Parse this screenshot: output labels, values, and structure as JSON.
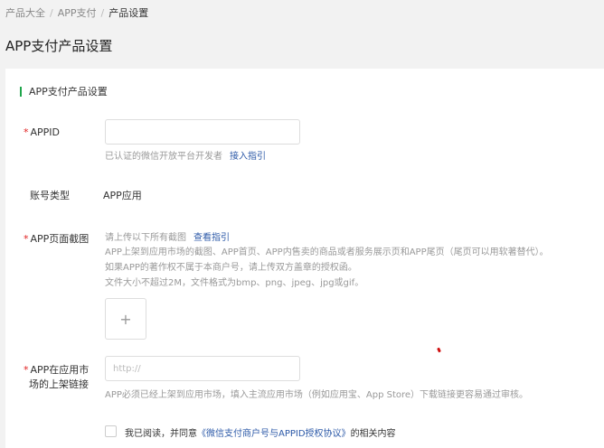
{
  "breadcrumb": {
    "items": [
      "产品大全",
      "APP支付",
      "产品设置"
    ]
  },
  "page_title": "APP支付产品设置",
  "section_title": "APP支付产品设置",
  "fields": {
    "appid": {
      "label": "APPID",
      "value": "",
      "hint": "已认证的微信开放平台开发者",
      "hint_link": "接入指引"
    },
    "account_type": {
      "label": "账号类型",
      "value": "APP应用"
    },
    "screenshot": {
      "label": "APP页面截图",
      "hint_line1": "请上传以下所有截图",
      "hint_link": "查看指引",
      "hint_line2": "APP上架到应用市场的截图、APP首页、APP内售卖的商品或者服务展示页和APP尾页（尾页可以用软著替代）。",
      "hint_line3": "如果APP的著作权不属于本商户号，请上传双方盖章的授权函。",
      "hint_line4": "文件大小不超过2M，文件格式为bmp、png、jpeg、jpg或gif。",
      "upload_icon": "+"
    },
    "market_link": {
      "label_line1": "APP在应用市",
      "label_line2": "场的上架链接",
      "placeholder": "http://",
      "hint": "APP必须已经上架到应用市场，填入主流应用市场（例如应用宝、App Store）下载链接更容易通过审核。"
    }
  },
  "agreement": {
    "prefix": "我已阅读，并同意",
    "link": "《微信支付商户号与APPID授权协议》",
    "suffix": "的相关内容"
  },
  "required_mark": "*",
  "colors": {
    "accent": "#1fa54b",
    "link": "#2d5aa8",
    "required": "#e02020"
  }
}
